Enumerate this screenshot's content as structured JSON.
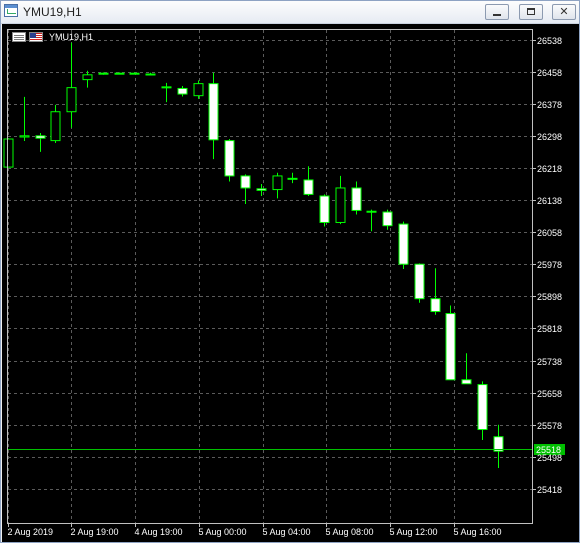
{
  "window": {
    "title": "YMU19,H1",
    "controls": {
      "minimize": "minimize",
      "maximize": "maximize",
      "close": "✕"
    }
  },
  "chart": {
    "symbol_label": "YMU19,H1",
    "colors": {
      "background": "#000000",
      "candle": "#00ff00",
      "grid": "#5b5b5b",
      "price_tag": "#00c000"
    }
  },
  "chart_data": {
    "type": "candlestick",
    "symbol": "YMU19",
    "timeframe": "H1",
    "y_ticks": [
      26538,
      26458,
      26378,
      26298,
      26218,
      26138,
      26058,
      25978,
      25898,
      25818,
      25738,
      25658,
      25578,
      25498,
      25418
    ],
    "x_ticks": [
      "2 Aug 2019",
      "2 Aug 19:00",
      "4 Aug 19:00",
      "5 Aug 00:00",
      "5 Aug 04:00",
      "5 Aug 08:00",
      "5 Aug 12:00",
      "5 Aug 16:00"
    ],
    "ylim": [
      25370,
      26575
    ],
    "current_price": 25518,
    "current_price_label": "25518",
    "grid": true,
    "candles": [
      {
        "o": 26220,
        "h": 26290,
        "l": 26220,
        "c": 26290
      },
      {
        "o": 26295,
        "h": 26395,
        "l": 26285,
        "c": 26298
      },
      {
        "o": 26298,
        "h": 26305,
        "l": 26258,
        "c": 26292
      },
      {
        "o": 26286,
        "h": 26375,
        "l": 26280,
        "c": 26358
      },
      {
        "o": 26358,
        "h": 26530,
        "l": 26318,
        "c": 26418
      },
      {
        "o": 26438,
        "h": 26460,
        "l": 26418,
        "c": 26450
      },
      {
        "o": 26452,
        "h": 26456,
        "l": 26450,
        "c": 26454
      },
      {
        "o": 26454,
        "h": 26456,
        "l": 26452,
        "c": 26454
      },
      {
        "o": 26454,
        "h": 26456,
        "l": 26452,
        "c": 26454
      },
      {
        "o": 26452,
        "h": 26455,
        "l": 26450,
        "c": 26452
      },
      {
        "o": 26420,
        "h": 26430,
        "l": 26382,
        "c": 26420
      },
      {
        "o": 26416,
        "h": 26422,
        "l": 26396,
        "c": 26402
      },
      {
        "o": 26398,
        "h": 26436,
        "l": 26390,
        "c": 26428
      },
      {
        "o": 26428,
        "h": 26455,
        "l": 26240,
        "c": 26288
      },
      {
        "o": 26286,
        "h": 26290,
        "l": 26184,
        "c": 26198
      },
      {
        "o": 26198,
        "h": 26202,
        "l": 26128,
        "c": 26168
      },
      {
        "o": 26166,
        "h": 26178,
        "l": 26148,
        "c": 26162
      },
      {
        "o": 26164,
        "h": 26206,
        "l": 26142,
        "c": 26198
      },
      {
        "o": 26192,
        "h": 26206,
        "l": 26180,
        "c": 26190
      },
      {
        "o": 26188,
        "h": 26222,
        "l": 26148,
        "c": 26152
      },
      {
        "o": 26148,
        "h": 26152,
        "l": 26072,
        "c": 26082
      },
      {
        "o": 26082,
        "h": 26198,
        "l": 26078,
        "c": 26168
      },
      {
        "o": 26168,
        "h": 26184,
        "l": 26102,
        "c": 26112
      },
      {
        "o": 26110,
        "h": 26114,
        "l": 26060,
        "c": 26108
      },
      {
        "o": 26108,
        "h": 26114,
        "l": 26064,
        "c": 26074
      },
      {
        "o": 26078,
        "h": 26084,
        "l": 25966,
        "c": 25978
      },
      {
        "o": 25978,
        "h": 25980,
        "l": 25882,
        "c": 25892
      },
      {
        "o": 25892,
        "h": 25968,
        "l": 25852,
        "c": 25860
      },
      {
        "o": 25855,
        "h": 25875,
        "l": 25735,
        "c": 25690
      },
      {
        "o": 25690,
        "h": 25756,
        "l": 25680,
        "c": 25680
      },
      {
        "o": 25678,
        "h": 25686,
        "l": 25540,
        "c": 25566
      },
      {
        "o": 25548,
        "h": 25578,
        "l": 25470,
        "c": 25512
      }
    ]
  }
}
